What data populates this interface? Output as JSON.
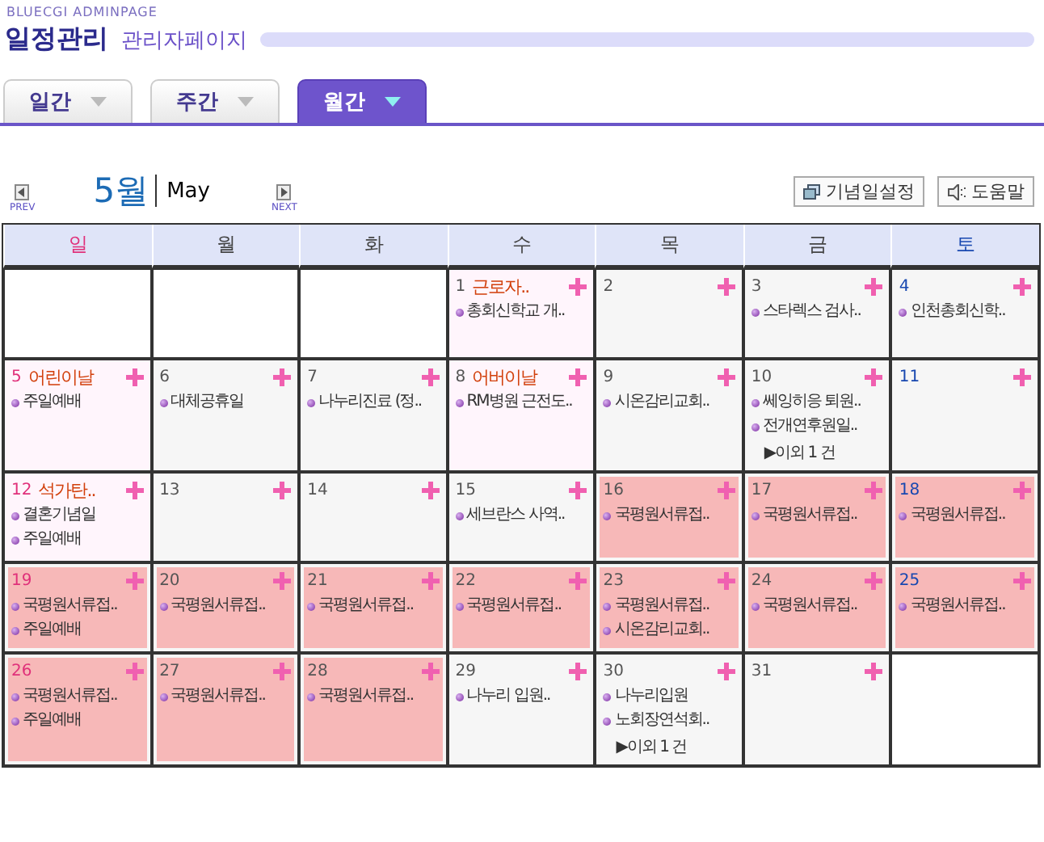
{
  "brand": "BLUECGI ADMINPAGE",
  "title": "일정관리",
  "subtitle": "관리자페이지",
  "tabs": [
    {
      "label": "일간",
      "selected": false
    },
    {
      "label": "주간",
      "selected": false
    },
    {
      "label": "월간",
      "selected": true
    }
  ],
  "month": {
    "prev": "PREV",
    "name": "5월",
    "english": "May",
    "next": "NEXT"
  },
  "buttons": [
    "기념일설정",
    "도움말"
  ],
  "weekdays": [
    "일",
    "월",
    "화",
    "수",
    "목",
    "금",
    "토"
  ],
  "weeks": [
    [
      {
        "kind": "blank"
      },
      {
        "kind": "blank"
      },
      {
        "kind": "blank"
      },
      {
        "day": "1",
        "holiday": "근로자..",
        "highlighted": false,
        "events": [
          "총회신학교 개.."
        ]
      },
      {
        "day": "2",
        "highlighted": false
      },
      {
        "day": "3",
        "highlighted": false,
        "events": [
          "스타렉스 검사.."
        ]
      },
      {
        "day": "4",
        "highlighted": false,
        "events": [
          "인천총회신학.."
        ]
      }
    ],
    [
      {
        "day": "5",
        "holiday": "어린이날",
        "highlighted": false,
        "events": [
          "주일예배"
        ]
      },
      {
        "day": "6",
        "highlighted": false,
        "events": [
          "대체공휴일"
        ]
      },
      {
        "day": "7",
        "highlighted": false,
        "events": [
          "나누리진료 (정.."
        ]
      },
      {
        "day": "8",
        "holiday": "어버이날",
        "highlighted": false,
        "events": [
          "RM병원 근전도.."
        ]
      },
      {
        "day": "9",
        "highlighted": false,
        "events": [
          "시온감리교회.."
        ]
      },
      {
        "day": "10",
        "highlighted": false,
        "events": [
          "쎄잉히응 퇴원..",
          "전개연후원일.."
        ],
        "more": "▶이외 1 건"
      },
      {
        "day": "11",
        "highlighted": false
      }
    ],
    [
      {
        "day": "12",
        "holiday": "석가탄..",
        "highlighted": false,
        "events": [
          "결혼기념일",
          "주일예배"
        ]
      },
      {
        "day": "13",
        "highlighted": false
      },
      {
        "day": "14",
        "highlighted": false
      },
      {
        "day": "15",
        "highlighted": false,
        "events": [
          "세브란스 사역.."
        ]
      },
      {
        "day": "16",
        "highlighted": true,
        "events": [
          "국평원서류접.."
        ]
      },
      {
        "day": "17",
        "highlighted": true,
        "events": [
          "국평원서류접.."
        ]
      },
      {
        "day": "18",
        "highlighted": true,
        "events": [
          "국평원서류접.."
        ]
      }
    ],
    [
      {
        "day": "19",
        "highlighted": true,
        "events": [
          "국평원서류접..",
          "주일예배"
        ]
      },
      {
        "day": "20",
        "highlighted": true,
        "events": [
          "국평원서류접.."
        ]
      },
      {
        "day": "21",
        "highlighted": true,
        "events": [
          "국평원서류접.."
        ]
      },
      {
        "day": "22",
        "highlighted": true,
        "events": [
          "국평원서류접.."
        ]
      },
      {
        "day": "23",
        "highlighted": true,
        "events": [
          "국평원서류접..",
          "시온감리교회.."
        ]
      },
      {
        "day": "24",
        "highlighted": true,
        "events": [
          "국평원서류접.."
        ]
      },
      {
        "day": "25",
        "highlighted": true,
        "events": [
          "국평원서류접.."
        ]
      }
    ],
    [
      {
        "day": "26",
        "highlighted": true,
        "events": [
          "국평원서류접..",
          "주일예배"
        ]
      },
      {
        "day": "27",
        "highlighted": true,
        "events": [
          "국평원서류접.."
        ]
      },
      {
        "day": "28",
        "highlighted": true,
        "events": [
          "국평원서류접.."
        ]
      },
      {
        "day": "29",
        "highlighted": false,
        "events": [
          "나누리 입원.."
        ]
      },
      {
        "day": "30",
        "highlighted": false,
        "events": [
          "나누리입원",
          "노회장연석회.."
        ],
        "more": "▶이외 1 건"
      },
      {
        "day": "31",
        "highlighted": false
      },
      {
        "kind": "blank"
      }
    ]
  ]
}
